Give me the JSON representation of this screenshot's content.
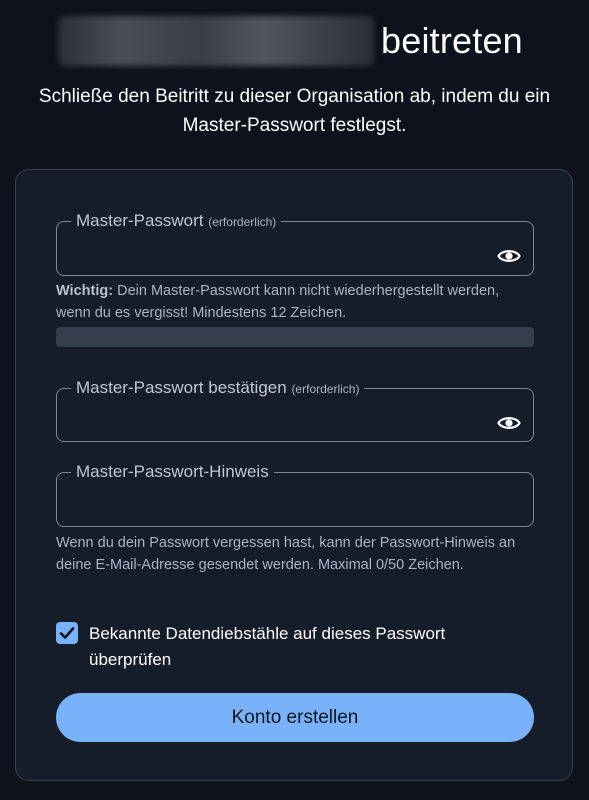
{
  "header": {
    "title_suffix": "beitreten",
    "subtitle": "Schließe den Beitritt zu dieser Organisation ab, indem du ein Master-Passwort festlegst."
  },
  "form": {
    "master_password": {
      "label": "Master-Passwort",
      "required_tag": "(erforderlich)",
      "value": "",
      "toggle_icon": "eye-icon"
    },
    "master_password_hint_text": {
      "bold": "Wichtig:",
      "text": " Dein Master-Passwort kann nicht wiederhergestellt werden, wenn du es vergisst! Mindestens 12 Zeichen."
    },
    "strength": {
      "level": 0,
      "color": "#343d4b"
    },
    "confirm_password": {
      "label": "Master-Passwort bestätigen",
      "required_tag": "(erforderlich)",
      "value": "",
      "toggle_icon": "eye-icon"
    },
    "password_hint": {
      "label": "Master-Passwort-Hinweis",
      "value": "",
      "help_text": "Wenn du dein Passwort vergessen hast, kann der Passwort-Hinweis an deine E-Mail-Adresse gesendet werden. Maximal 0/50 Zeichen."
    },
    "breach_check": {
      "label": "Bekannte Datendiebstähle auf dieses Passwort überprüfen",
      "checked": true
    },
    "submit_label": "Konto erstellen"
  },
  "colors": {
    "background": "#0d121c",
    "card": "#161d2a",
    "accent": "#79b2fb",
    "text_muted": "#aab4c4"
  }
}
